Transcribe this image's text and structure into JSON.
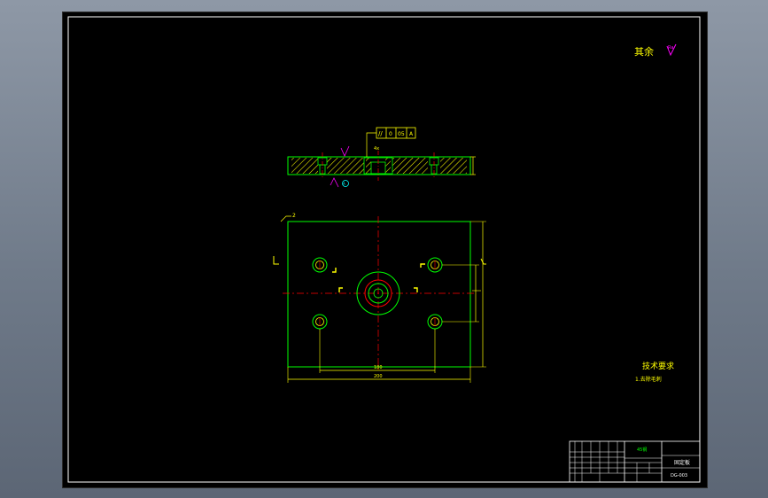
{
  "roughness_note": "其余",
  "section_view": {
    "tolerance_frame": [
      "//",
      "0",
      "05",
      "A"
    ],
    "leader_label": "4x",
    "datum_label": "A"
  },
  "plan_view": {
    "tag": "2",
    "dim_inner_width": "180",
    "dim_outer_width": "200"
  },
  "technical_requirements": {
    "title": "技术要求",
    "item1": "1.去除毛刺"
  },
  "title_block": {
    "material": "45钢",
    "part_name": "固定板",
    "drawing_no": "DG-003"
  },
  "colors": {
    "background": "#000000",
    "outline": "#ffffff",
    "part": "#00ff00",
    "dimension": "#ffff00",
    "centerline": "#ff0000",
    "symbol": "#ff00ff"
  }
}
